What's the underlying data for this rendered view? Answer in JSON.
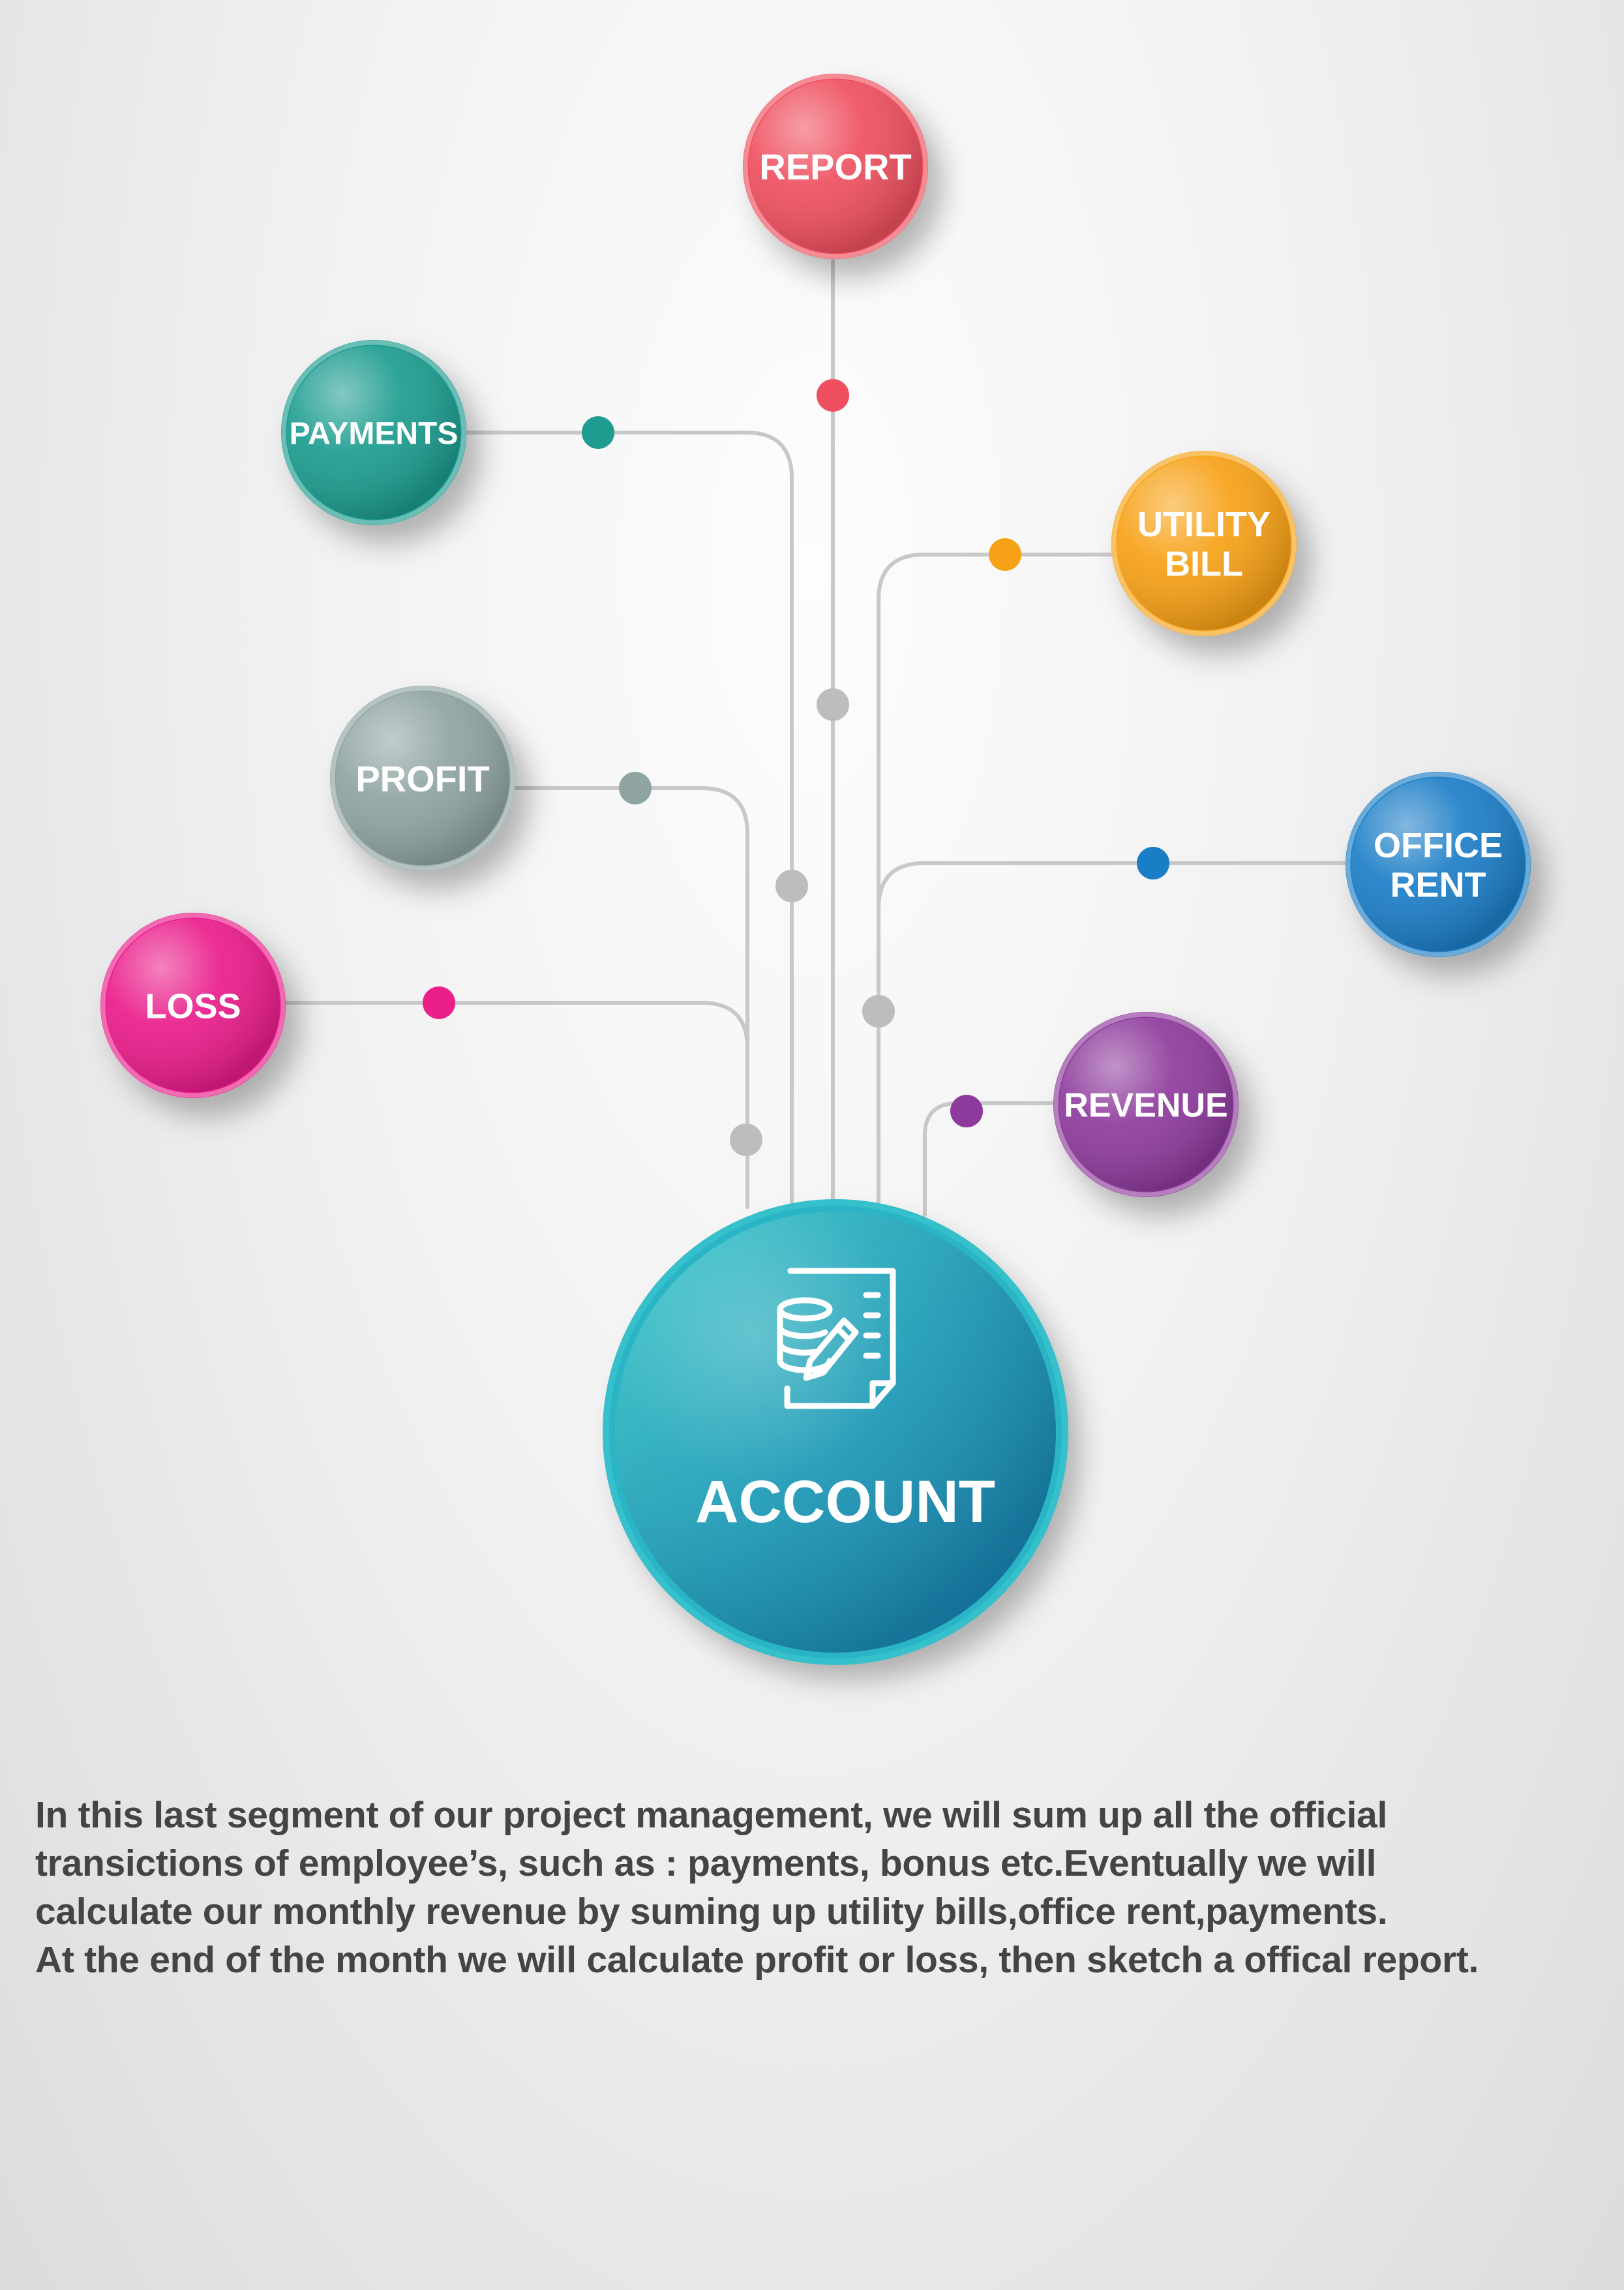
{
  "diagram": {
    "center": {
      "label": "ACCOUNT",
      "icon": "database-document-edit-icon",
      "color": "#1f9ab8"
    },
    "nodes": [
      {
        "key": "report",
        "lines": [
          "REPORT"
        ],
        "color": "#ef4f5f"
      },
      {
        "key": "payments",
        "lines": [
          "PAYMENTS"
        ],
        "color": "#1e9c8f"
      },
      {
        "key": "utility-bill",
        "lines": [
          "UTILITY",
          "BILL"
        ],
        "color": "#f7a116"
      },
      {
        "key": "profit",
        "lines": [
          "PROFIT"
        ],
        "color": "#8fa4a3"
      },
      {
        "key": "office-rent",
        "lines": [
          "OFFICE",
          "RENT"
        ],
        "color": "#1a7ec7"
      },
      {
        "key": "loss",
        "lines": [
          "LOSS"
        ],
        "color": "#ea1f8a"
      },
      {
        "key": "revenue",
        "lines": [
          "REVENUE"
        ],
        "color": "#8e3a9c"
      }
    ],
    "connector_color": "#c8c8ca",
    "junction_color": "#bdbdbf"
  },
  "description": {
    "lines": [
      "In this last segment of our project management, we will sum up all the official",
      "transictions of employee’s, such as : payments, bonus etc.Eventually we will",
      "calculate our monthly revenue by suming up utility bills,office rent,payments.",
      "At the end of the month we will calculate profit or loss, then sketch a offical report."
    ]
  }
}
